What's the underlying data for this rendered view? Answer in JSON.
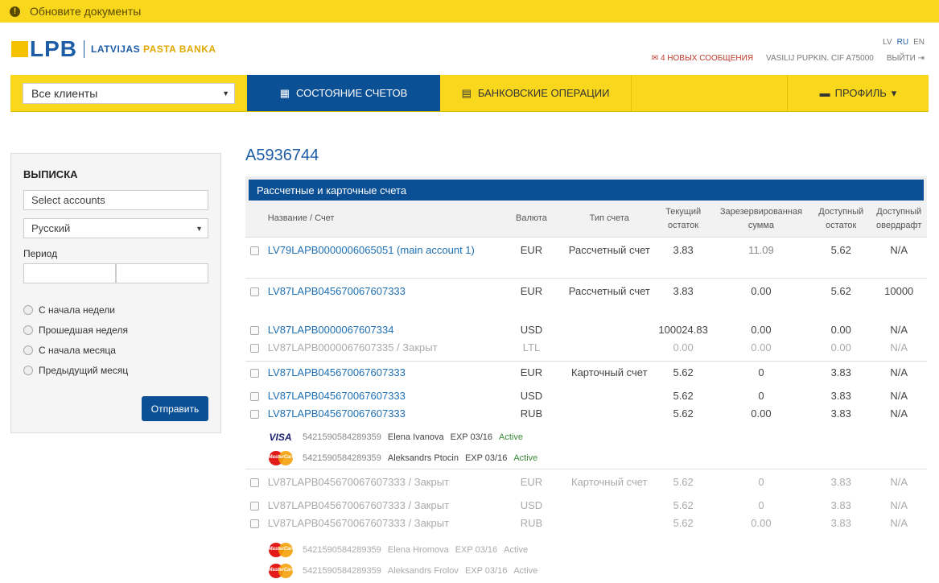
{
  "notice": {
    "text": "Обновите документы"
  },
  "logo": {
    "short": "LPB",
    "full_a": "LATVIJAS ",
    "full_b": "PASTA BANKA"
  },
  "langs": [
    "LV",
    "RU",
    "EN"
  ],
  "userbar": {
    "messages": "4 НОВЫХ СООБЩЕНИЯ",
    "user": "VASILIJ PUPKIN. CIF A75000",
    "logout": "ВЫЙТИ"
  },
  "nav": {
    "client_select": "Все клиенты",
    "tab_accounts": "СОСТОЯНИЕ СЧЕТОВ",
    "tab_operations": "БАНКОВСКИЕ ОПЕРАЦИИ",
    "tab_profile": "ПРОФИЛЬ"
  },
  "sidebar": {
    "title": "ВЫПИСКА",
    "accounts_placeholder": "Select accounts",
    "language": "Русский",
    "period_label": "Период",
    "radios": [
      "С начала недели",
      "Прошедшая неделя",
      "С начала месяца",
      "Предыдущий месяц"
    ],
    "submit": "Отправить"
  },
  "main": {
    "account_id": "A5936744",
    "section_title": "Рассчетные и карточные счета",
    "headers": {
      "name": "Название / Счет",
      "currency": "Валюта",
      "type": "Тип счета",
      "balance": "Текущий остаток",
      "reserved": "Зарезервированная сумма",
      "available": "Доступный остаток",
      "overdraft": "Доступный овердрафт"
    },
    "rows": [
      {
        "name": "LV79LAPB0000006065051 (main account 1)",
        "cur": "EUR",
        "type": "Рассчетный счет",
        "bal": "3.83",
        "res": "11.09",
        "av": "5.62",
        "od": "N/A"
      },
      {
        "name": "LV87LAPB045670067607333",
        "cur": "EUR",
        "type": "Рассчетный счет",
        "bal": "3.83",
        "res": "0.00",
        "av": "5.62",
        "od": "10000"
      },
      {
        "name": "LV87LAPB0000067607334",
        "cur": "USD",
        "type": "",
        "bal": "100024.83",
        "res": "0.00",
        "av": "0.00",
        "od": "N/A"
      },
      {
        "name": "LV87LAPB0000067607335 / Закрыт",
        "cur": "LTL",
        "type": "",
        "bal": "0.00",
        "res": "0.00",
        "av": "0.00",
        "od": "N/A"
      },
      {
        "name": "LV87LAPB045670067607333",
        "cur": "EUR",
        "type": "Карточный счет",
        "bal": "5.62",
        "res": "0",
        "av": "3.83",
        "od": "N/A"
      },
      {
        "name": "LV87LAPB045670067607333",
        "cur": "USD",
        "type": "",
        "bal": "5.62",
        "res": "0",
        "av": "3.83",
        "od": "N/A"
      },
      {
        "name": "LV87LAPB045670067607333",
        "cur": "RUB",
        "type": "",
        "bal": "5.62",
        "res": "0.00",
        "av": "3.83",
        "od": "N/A"
      },
      {
        "name": "LV87LAPB045670067607333 / Закрыт",
        "cur": "EUR",
        "type": "Карточный счет",
        "bal": "5.62",
        "res": "0",
        "av": "3.83",
        "od": "N/A"
      },
      {
        "name": "LV87LAPB045670067607333 / Закрыт",
        "cur": "USD",
        "type": "",
        "bal": "5.62",
        "res": "0",
        "av": "3.83",
        "od": "N/A"
      },
      {
        "name": "LV87LAPB045670067607333 / Закрыт",
        "cur": "RUB",
        "type": "",
        "bal": "5.62",
        "res": "0.00",
        "av": "3.83",
        "od": "N/A"
      }
    ],
    "cards": [
      {
        "brand": "VISA",
        "num": "5421590584289359",
        "holder": "Elena Ivanova",
        "exp": "EXP 03/16",
        "status": "Active"
      },
      {
        "brand": "MasterCard",
        "num": "5421590584289359",
        "holder": "Aleksandrs Ptocin",
        "exp": "EXP 03/16",
        "status": "Active"
      },
      {
        "brand": "MasterCard",
        "num": "5421590584289359",
        "holder": "Elena Hromova",
        "exp": "EXP 03/16",
        "status": "Active"
      },
      {
        "brand": "MasterCard",
        "num": "5421590584289359",
        "holder": "Aleksandrs Frolov",
        "exp": "EXP 03/16",
        "status": "Active"
      }
    ]
  }
}
